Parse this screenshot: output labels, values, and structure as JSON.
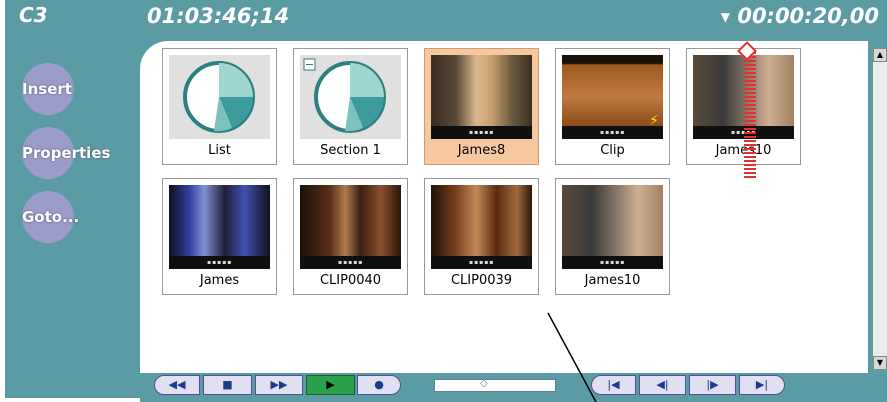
{
  "channel": "C3",
  "timecode": "01:03:46;14",
  "duration": "00:00:20,00",
  "sidebar": {
    "buttons": [
      {
        "label": "Insert"
      },
      {
        "label": "Properties"
      },
      {
        "label": "Goto..."
      }
    ]
  },
  "clips": [
    {
      "label": "List",
      "kind": "pie"
    },
    {
      "label": "Section 1",
      "kind": "pie"
    },
    {
      "label": "James8",
      "kind": "video",
      "selected": true
    },
    {
      "label": "Clip",
      "kind": "video"
    },
    {
      "label": "James10",
      "kind": "video"
    },
    {
      "label": "James",
      "kind": "video"
    },
    {
      "label": "CLIP0040",
      "kind": "video"
    },
    {
      "label": "CLIP0039",
      "kind": "video"
    },
    {
      "label": "James10",
      "kind": "video"
    }
  ],
  "transport": {
    "left": [
      "rewind-icon",
      "stop-icon",
      "fast-forward-icon",
      "play-icon",
      "record-icon"
    ],
    "right": [
      "goto-start-icon",
      "step-back-icon",
      "step-forward-icon",
      "goto-end-icon"
    ]
  },
  "colors": {
    "panel": "#5b9ca4",
    "selected": "#f6c8a0",
    "play": "#2aa04a",
    "marker": "#e03030"
  }
}
